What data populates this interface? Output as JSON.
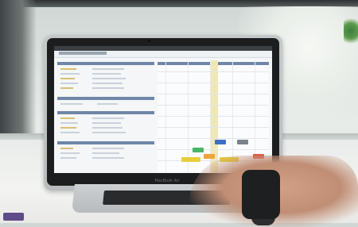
{
  "scene": {
    "description_icons": [
      "laptop-icon",
      "hand-icon",
      "watch-icon"
    ],
    "laptop_logo_text": "MacBook Air"
  },
  "colors": {
    "screen_header": "#6f86a6",
    "event_green": "#4bb36a",
    "event_blue": "#3e6fc4",
    "event_gray": "#7b8289",
    "event_yellow": "#e7cf3a",
    "event_orange": "#f0a43a",
    "event_red": "#e05a44"
  }
}
